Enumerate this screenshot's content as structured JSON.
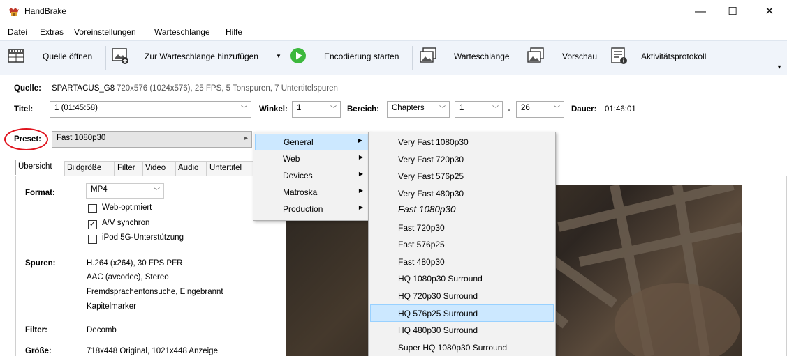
{
  "window": {
    "title": "HandBrake",
    "min": "—",
    "max": "☐",
    "close": "✕"
  },
  "menu": [
    "Datei",
    "Extras",
    "Voreinstellungen",
    "Warteschlange",
    "Hilfe"
  ],
  "toolbar": {
    "open_source": "Quelle öffnen",
    "add_queue": "Zur Warteschlange hinzufügen",
    "start": "Encodierung starten",
    "queue": "Warteschlange",
    "preview": "Vorschau",
    "activity": "Aktivitätsprotokoll"
  },
  "source": {
    "label": "Quelle:",
    "name": "SPARTACUS_G8",
    "info": "720x576 (1024x576), 25 FPS, 5 Tonspuren, 7 Untertitelspuren"
  },
  "title_row": {
    "title_label": "Titel:",
    "title_value": "1 (01:45:58)",
    "angle_label": "Winkel:",
    "angle_value": "1",
    "range_label": "Bereich:",
    "range_type": "Chapters",
    "range_start": "1",
    "range_dash": "-",
    "range_end": "26",
    "duration_label": "Dauer:",
    "duration_value": "01:46:01"
  },
  "preset": {
    "label": "Preset:",
    "value": "Fast 1080p30",
    "arrow": "▸"
  },
  "tabs": [
    "Übersicht",
    "Bildgröße",
    "Filter",
    "Video",
    "Audio",
    "Untertitel"
  ],
  "summary": {
    "format_label": "Format:",
    "format_value": "MP4",
    "web_optimized": "Web-optimiert",
    "av_sync": "A/V synchron",
    "ipod": "iPod 5G-Unterstützung",
    "tracks_label": "Spuren:",
    "tracks": [
      "H.264 (x264), 30 FPS PFR",
      "AAC (avcodec), Stereo",
      "Fremdsprachentonsuche, Eingebrannt",
      "Kapitelmarker"
    ],
    "filter_label": "Filter:",
    "filter_value": "Decomb",
    "size_label": "Größe:",
    "size_value": "718x448 Original, 1021x448 Anzeige"
  },
  "preset_menu": [
    "General",
    "Web",
    "Devices",
    "Matroska",
    "Production"
  ],
  "general_submenu": [
    "Very Fast 1080p30",
    "Very Fast 720p30",
    "Very Fast 576p25",
    "Very Fast 480p30",
    "Fast 1080p30",
    "Fast 720p30",
    "Fast 576p25",
    "Fast 480p30",
    "HQ 1080p30 Surround",
    "HQ 720p30 Surround",
    "HQ 576p25 Surround",
    "HQ 480p30 Surround",
    "Super HQ 1080p30 Surround"
  ],
  "checkmark": "✓",
  "colors": {
    "accent_ring": "#e0141e",
    "selection": "#cce8ff",
    "play_green": "#3db83d"
  }
}
